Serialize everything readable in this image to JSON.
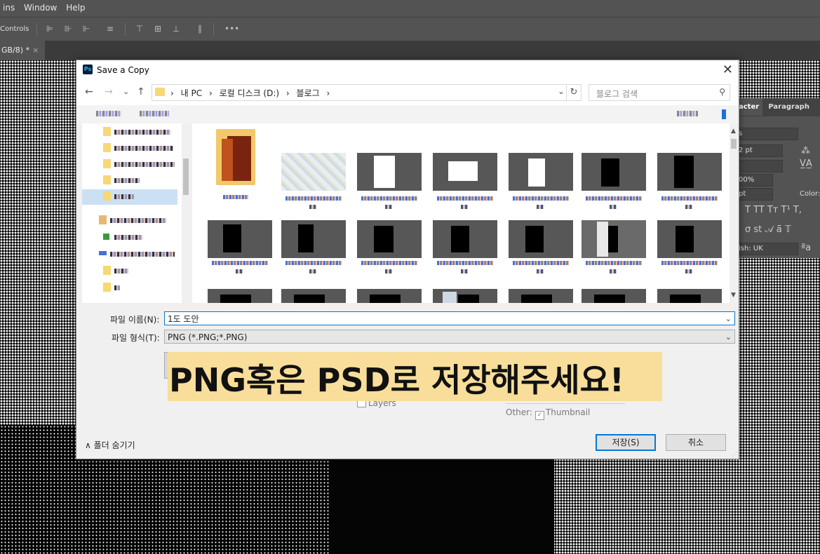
{
  "app": {
    "menu": [
      "ins",
      "Window",
      "Help"
    ],
    "options_label": "Controls",
    "more_glyph": "•••",
    "doc_tab": {
      "label": "GB/8) *",
      "close": "×"
    }
  },
  "character_panel": {
    "tabs": [
      "acter",
      "Paragraph"
    ],
    "fields": [
      "s",
      "2 pt",
      "",
      "00%",
      "pt"
    ],
    "color_label": "Color:",
    "language": "ish: UK",
    "aa_glyph": "ªa",
    "style_glyphs": "T TT Tт T¹ T,"
  },
  "dialog": {
    "title": "Save a Copy",
    "ps_logo": "Ps",
    "close_glyph": "✕",
    "nav": {
      "back": "←",
      "forward": "→",
      "recent": "⌄",
      "up": "↑"
    },
    "breadcrumbs": [
      "내 PC",
      "›",
      "로컬 디스크 (D:)",
      "›",
      "블로그",
      "›"
    ],
    "breadcrumb_lead": "›",
    "search_placeholder": "블로그 검색",
    "refresh_glyph": "↻",
    "search_glyph": "⚲",
    "file_name_label": "파일 이름(N):",
    "file_name_value": "1도 도안",
    "file_type_label": "파일 형식(T):",
    "file_type_value": "PNG (*.PNG;*.PNG)",
    "layers_label": "Layers",
    "other_label": "Other:",
    "thumbnail_label": "Thumbnail",
    "thumbnail_check": "✓",
    "hide_folders": "∧  폴더 숨기기",
    "save_button": "저장(S)",
    "cancel_button": "취소",
    "dropdown_glyph": "⌄"
  },
  "banner": {
    "text": "PNG혹은 PSD로 저장해주세요!"
  },
  "colors": {
    "photoshop_bar": "#535353",
    "highlight": "#f8de9a",
    "selection": "#cce0f3",
    "accent": "#0078d7"
  }
}
